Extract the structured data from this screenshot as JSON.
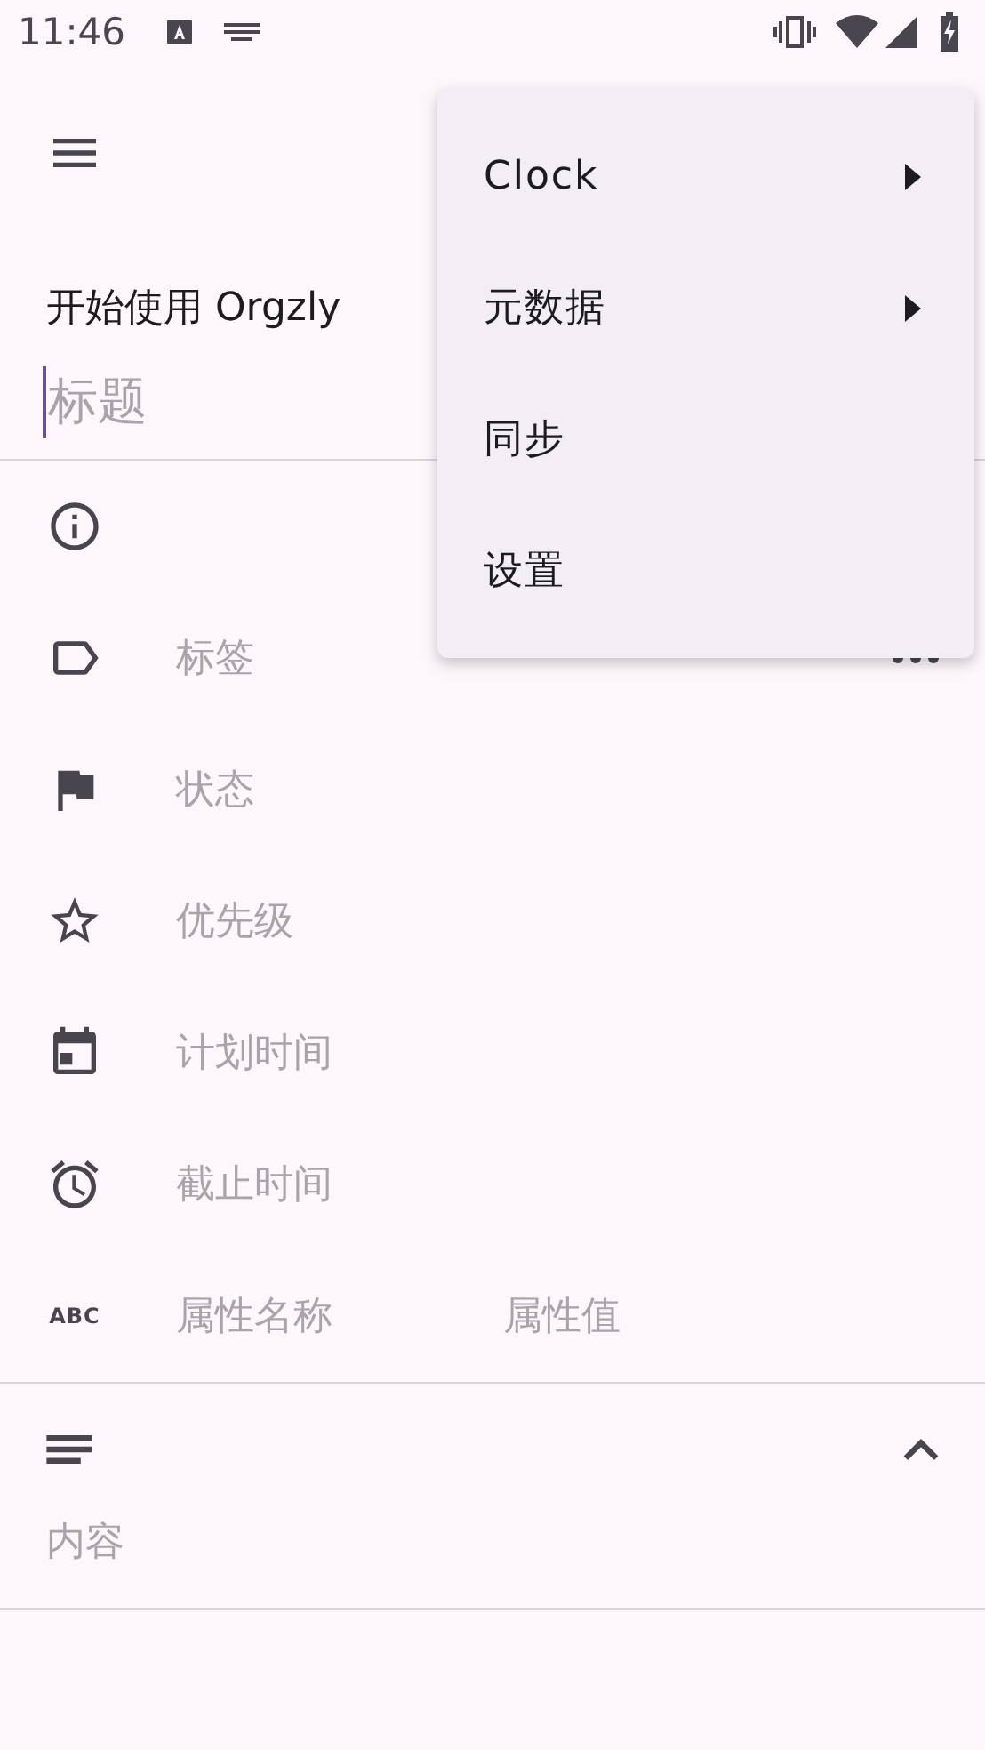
{
  "status_bar": {
    "time": "11:46"
  },
  "book": "开始使用 Orgzly",
  "title_field": {
    "placeholder": "标题",
    "focused": true
  },
  "fields": [
    {
      "kind": "info"
    },
    {
      "kind": "tags",
      "placeholder": "标签",
      "has_more": true
    },
    {
      "kind": "state",
      "placeholder": "状态"
    },
    {
      "kind": "priority",
      "placeholder": "优先级"
    },
    {
      "kind": "scheduled",
      "placeholder": "计划时间"
    },
    {
      "kind": "deadline",
      "placeholder": "截止时间"
    },
    {
      "kind": "property",
      "icon_text": "ABC",
      "placeholder": "属性名称",
      "value_placeholder": "属性值"
    }
  ],
  "content": {
    "expanded": true,
    "placeholder": "内容"
  },
  "menu": [
    {
      "label": "Clock",
      "submenu": true
    },
    {
      "label": "元数据",
      "submenu": true
    },
    {
      "label": "同步",
      "submenu": false
    },
    {
      "label": "设置",
      "submenu": false
    }
  ]
}
